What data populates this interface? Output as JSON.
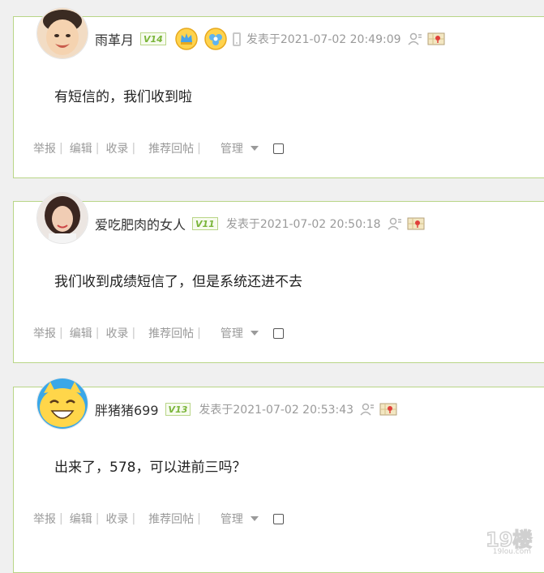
{
  "actions": {
    "report": "举报",
    "edit": "编辑",
    "collect": "收录",
    "recommend": "推荐回帖",
    "manage": "管理",
    "separator": "|"
  },
  "posts": [
    {
      "username": "雨革月",
      "level": "14",
      "date": "发表于2021-07-02 20:49:09",
      "content": "有短信的，我们收到啦",
      "has_medals": true,
      "has_phone": true
    },
    {
      "username": "爱吃肥肉的女人",
      "level": "11",
      "date": "发表于2021-07-02 20:50:18",
      "content": "我们收到成绩短信了，但是系统还进不去"
    },
    {
      "username": "胖猪猪699",
      "level": "13",
      "date": "发表于2021-07-02 20:53:43",
      "content": "出来了，578，可以进前三吗？"
    }
  ],
  "watermark": {
    "logo": "19楼",
    "url": "19lou.com"
  },
  "colors": {
    "border": "#b8d587",
    "level": "#7ab53a",
    "muted": "#9a9a9a"
  }
}
